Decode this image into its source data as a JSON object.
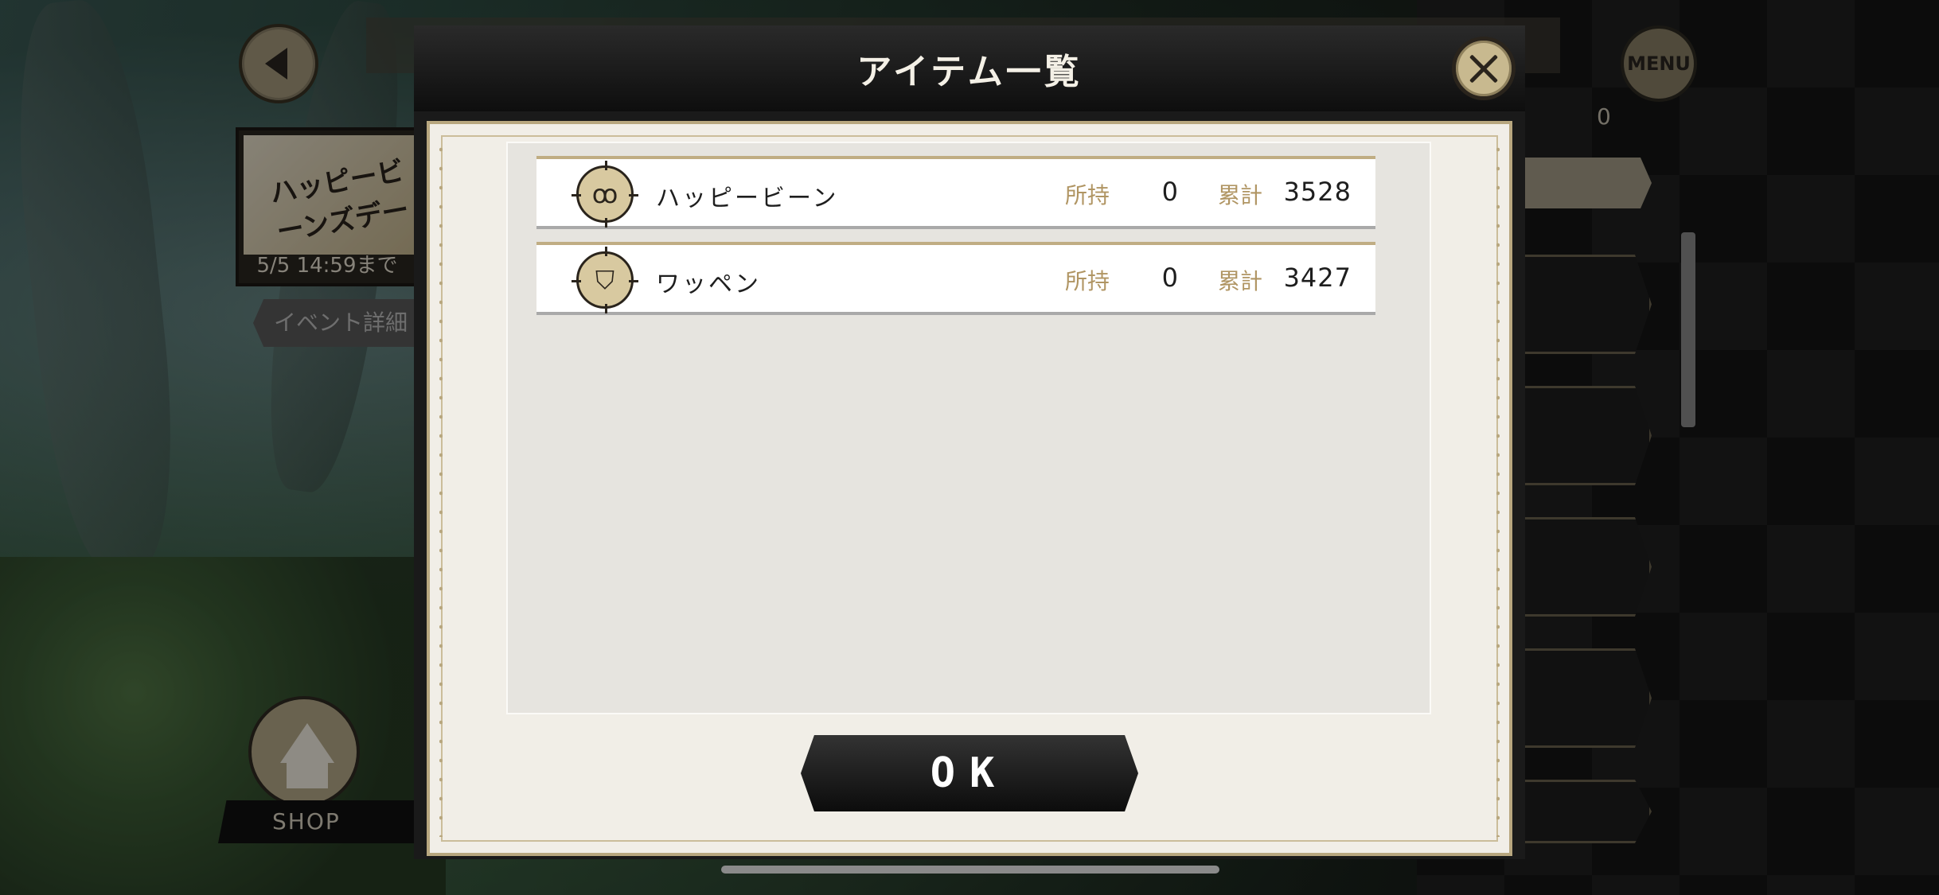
{
  "background": {
    "event_banner": {
      "title": "ハッピービーンズデー",
      "date": "5/5 14:59まで"
    },
    "event_detail_button": "イベント詳細",
    "shop_label": "SHOP",
    "menu_label": "MENU",
    "count_display": "0"
  },
  "modal": {
    "title": "アイテム一覧",
    "items": [
      {
        "name": "ハッピービーン",
        "owned_label": "所持",
        "owned": "0",
        "total_label": "累計",
        "total": "3528",
        "icon": "bean-icon"
      },
      {
        "name": "ワッペン",
        "owned_label": "所持",
        "owned": "0",
        "total_label": "累計",
        "total": "3427",
        "icon": "badge-icon"
      }
    ],
    "ok_label": "OK"
  },
  "colors": {
    "accent_gold": "#b09563",
    "header_dark": "#0e0e0e",
    "paper": "#f1eee7"
  }
}
